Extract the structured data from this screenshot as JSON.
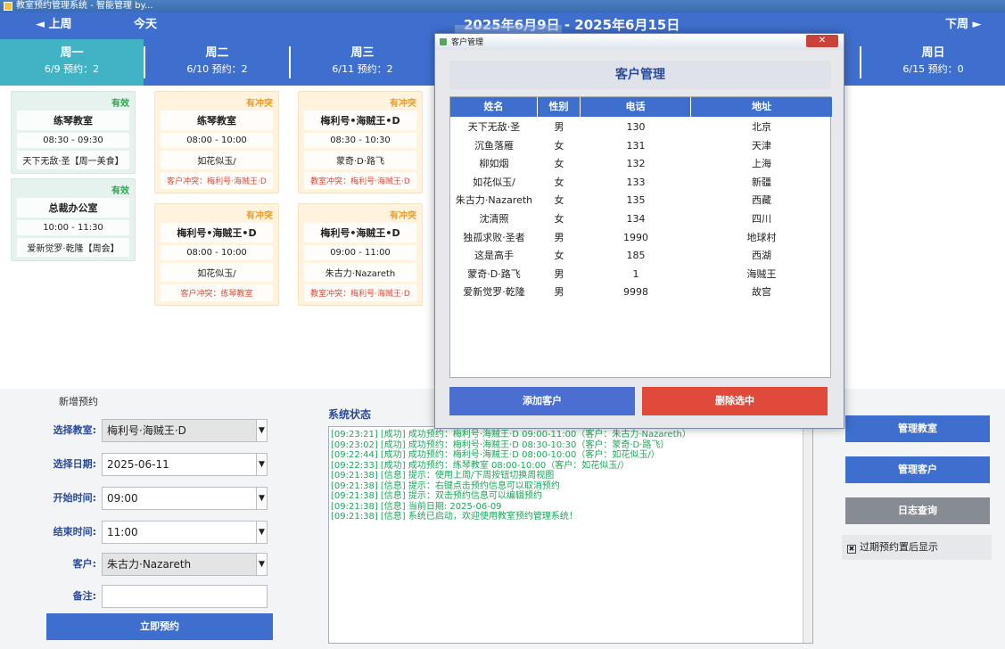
{
  "window": {
    "title": "教室预约管理系统 - 智能管理 by..."
  },
  "topbar": {
    "prev_week": "◄ 上周",
    "today": "今天",
    "week_range": "2025年6月9日 - 2025年6月15日",
    "next_week": "下周 ►"
  },
  "days": [
    {
      "name": "周一",
      "sub": "6/9  预约：2"
    },
    {
      "name": "周二",
      "sub": "6/10  预约：2"
    },
    {
      "name": "周三",
      "sub": "6/11  预约：2"
    },
    {
      "name": "周日",
      "sub": "6/15  预约：0"
    }
  ],
  "cards": [
    {
      "status": "有效",
      "room": "练琴教室",
      "time": "08:30 - 09:30",
      "customer": "天下无敌·圣【周一美食】",
      "conflict": ""
    },
    {
      "status": "有效",
      "room": "总裁办公室",
      "time": "10:00 - 11:30",
      "customer": "爱新觉罗·乾隆【周会】",
      "conflict": ""
    },
    {
      "status": "有冲突",
      "room": "练琴教室",
      "time": "08:00 - 10:00",
      "customer": "如花似玉/",
      "conflict": "客户冲突：梅利号·海贼王·D"
    },
    {
      "status": "有冲突",
      "room": "梅利号•海贼王•D",
      "time": "08:00 - 10:00",
      "customer": "如花似玉/",
      "conflict": "客户冲突：练琴教室"
    },
    {
      "status": "有冲突",
      "room": "梅利号•海贼王•D",
      "time": "08:30 - 10:30",
      "customer": "蒙奇·D·路飞",
      "conflict": "教室冲突：梅利号·海贼王·D"
    },
    {
      "status": "有冲突",
      "room": "梅利号•海贼王•D",
      "time": "09:00 - 11:00",
      "customer": "朱古力·Nazareth",
      "conflict": "教室冲突：梅利号·海贼王·D"
    }
  ],
  "form": {
    "section_label": "新增预约",
    "room_label": "选择教室:",
    "room_value": "梅利号·海贼王·D",
    "date_label": "选择日期:",
    "date_value": "2025-06-11",
    "start_label": "开始时间:",
    "start_value": "09:00",
    "end_label": "结束时间:",
    "end_value": "11:00",
    "customer_label": "客户:",
    "customer_value": "朱古力·Nazareth",
    "note_label": "备注:",
    "note_value": "",
    "submit_label": "立即预约"
  },
  "status": {
    "label": "系统状态",
    "lines": [
      "[09:23:21] [成功] 成功预约：梅利号·海贼王·D 09:00-11:00（客户：朱古力·Nazareth）",
      "[09:23:02] [成功] 成功预约：梅利号·海贼王·D 08:30-10:30（客户：蒙奇·D·路飞）",
      "[09:22:44] [成功] 成功预约：梅利号·海贼王·D 08:00-10:00（客户：如花似玉/）",
      "[09:22:33] [成功] 成功预约：练琴教室 08:00-10:00（客户：如花似玉/）",
      "[09:21:38] [信息] 提示：使用上周/下周按钮切换周视图",
      "[09:21:38] [信息] 提示：右键点击预约信息可以取消预约",
      "[09:21:38] [信息] 提示：双击预约信息可以编辑预约",
      "[09:21:38] [信息] 当前日期: 2025-06-09",
      "[09:21:38] [信息] 系统已启动，欢迎使用教室预约管理系统！"
    ]
  },
  "right": {
    "manage_room": "管理教室",
    "manage_customer": "管理客户",
    "log": "日志查询",
    "expired_label": "过期预约置后显示",
    "expired_mark": "✖"
  },
  "modal": {
    "title": "客户管理",
    "close": "✕",
    "heading": "客户管理",
    "columns": [
      "姓名",
      "性别",
      "电话",
      "地址"
    ],
    "rows": [
      [
        "天下无敌·圣",
        "男",
        "130",
        "北京"
      ],
      [
        "沉鱼落雁",
        "女",
        "131",
        "天津"
      ],
      [
        "柳如烟",
        "女",
        "132",
        "上海"
      ],
      [
        "如花似玉/",
        "女",
        "133",
        "新疆"
      ],
      [
        "朱古力·Nazareth",
        "女",
        "135",
        "西藏"
      ],
      [
        "沈清照",
        "女",
        "134",
        "四川"
      ],
      [
        "独孤求败·圣者",
        "男",
        "1990",
        "地球村"
      ],
      [
        "这是高手",
        "女",
        "185",
        "西湖"
      ],
      [
        "蒙奇·D·路飞",
        "男",
        "1",
        "海贼王"
      ],
      [
        "爱新觉罗·乾隆",
        "男",
        "9998",
        "故宫"
      ]
    ],
    "add_label": "添加客户",
    "delete_label": "删除选中",
    "colors": {
      "add": "#4a6fd1",
      "delete": "#e04a3a"
    }
  }
}
